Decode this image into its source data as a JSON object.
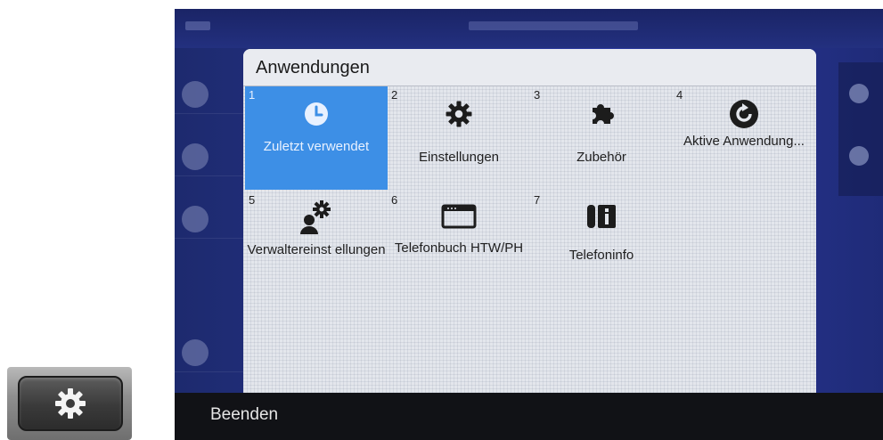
{
  "dialog": {
    "title": "Anwendungen",
    "items": [
      {
        "number": "1",
        "label": "Zuletzt verwendet",
        "icon": "clock-icon",
        "selected": true
      },
      {
        "number": "2",
        "label": "Einstellungen",
        "icon": "gear-icon",
        "selected": false
      },
      {
        "number": "3",
        "label": "Zubehör",
        "icon": "puzzle-icon",
        "selected": false
      },
      {
        "number": "4",
        "label": "Aktive Anwendung...",
        "icon": "refresh-icon",
        "selected": false
      },
      {
        "number": "5",
        "label": "Verwaltereinst ellungen",
        "icon": "admin-settings-icon",
        "selected": false
      },
      {
        "number": "6",
        "label": "Telefonbuch HTW/PH",
        "icon": "window-icon",
        "selected": false
      },
      {
        "number": "7",
        "label": "Telefoninfo",
        "icon": "phone-info-icon",
        "selected": false
      }
    ]
  },
  "softkeys": {
    "exit_label": "Beenden"
  },
  "hardware_key": {
    "icon": "gear-icon"
  },
  "colors": {
    "selected_tile": "#3d8fe6",
    "softkey_bar": "#111216",
    "dialog_bg": "#e3e6ec"
  }
}
